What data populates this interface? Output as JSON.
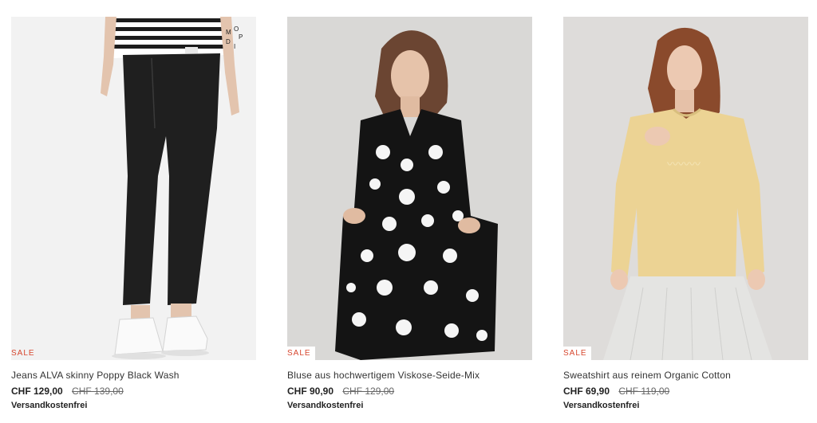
{
  "products": [
    {
      "badge": "SALE",
      "title": "Jeans ALVA skinny Poppy Black Wash",
      "price_now": "CHF 129,00",
      "price_old": "CHF 139,00",
      "shipping": "Versandkostenfrei",
      "logo_letters": [
        "M",
        "O",
        "P",
        "D",
        "I"
      ]
    },
    {
      "badge": "SALE",
      "title": "Bluse aus hochwertigem Viskose-Seide-Mix",
      "price_now": "CHF 90,90",
      "price_old": "CHF 129,00",
      "shipping": "Versandkostenfrei"
    },
    {
      "badge": "SALE",
      "title": "Sweatshirt aus reinem Organic Cotton",
      "price_now": "CHF 69,90",
      "price_old": "CHF 119,00",
      "shipping": "Versandkostenfrei"
    }
  ],
  "colors": {
    "sale": "#d7472f",
    "photo_bg_1": "#f2f2f2",
    "photo_bg_2": "#d9d8d6",
    "photo_bg_3": "#dedcda"
  }
}
